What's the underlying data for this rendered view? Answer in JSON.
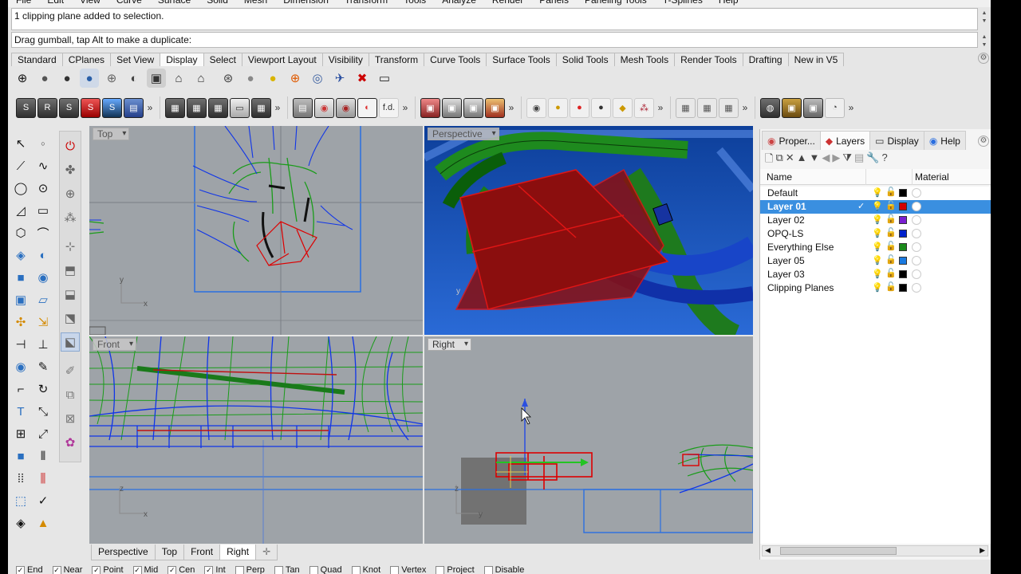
{
  "menu": [
    "File",
    "Edit",
    "View",
    "Curve",
    "Surface",
    "Solid",
    "Mesh",
    "Dimension",
    "Transform",
    "Tools",
    "Analyze",
    "Render",
    "Panels",
    "Paneling Tools",
    "T-Splines",
    "Help"
  ],
  "command_history": "1 clipping plane added to selection.",
  "command_prompt": "Drag gumball, tap Alt to make a duplicate:",
  "toolbar_tabs": [
    "Standard",
    "CPlanes",
    "Set View",
    "Display",
    "Select",
    "Viewport Layout",
    "Visibility",
    "Transform",
    "Curve Tools",
    "Surface Tools",
    "Solid Tools",
    "Mesh Tools",
    "Render Tools",
    "Drafting",
    "New in V5"
  ],
  "active_toolbar_tab": "Display",
  "fd_label": "f.d.",
  "viewports": {
    "top": "Top",
    "perspective": "Perspective",
    "front": "Front",
    "right": "Right"
  },
  "axis": {
    "x": "x",
    "y": "y",
    "z": "z"
  },
  "viewport_tabs": [
    "Perspective",
    "Top",
    "Front",
    "Right"
  ],
  "active_viewport_tab": "Right",
  "add_tab_glyph": "✛",
  "panel_tabs": [
    "Proper...",
    "Layers",
    "Display",
    "Help"
  ],
  "active_panel_tab": "Layers",
  "layers_header": {
    "name": "Name",
    "material": "Material"
  },
  "layers": [
    {
      "name": "Default",
      "color": "#000000",
      "current": false,
      "selected": false
    },
    {
      "name": "Layer 01",
      "color": "#d40000",
      "current": true,
      "selected": true
    },
    {
      "name": "Layer 02",
      "color": "#7a1fd1",
      "current": false,
      "selected": false
    },
    {
      "name": "OPQ-LS",
      "color": "#0022cc",
      "current": false,
      "selected": false
    },
    {
      "name": "Everything Else",
      "color": "#1a8a1a",
      "current": false,
      "selected": false
    },
    {
      "name": "Layer 05",
      "color": "#1a7ae0",
      "current": false,
      "selected": false
    },
    {
      "name": "Layer 03",
      "color": "#000000",
      "current": false,
      "selected": false
    },
    {
      "name": "Clipping Planes",
      "color": "#000000",
      "current": false,
      "selected": false
    }
  ],
  "osnaps": [
    "End",
    "Near",
    "Point",
    "Mid",
    "Cen",
    "Int",
    "Perp",
    "Tan",
    "Quad",
    "Knot",
    "Vertex",
    "Project",
    "Disable"
  ]
}
